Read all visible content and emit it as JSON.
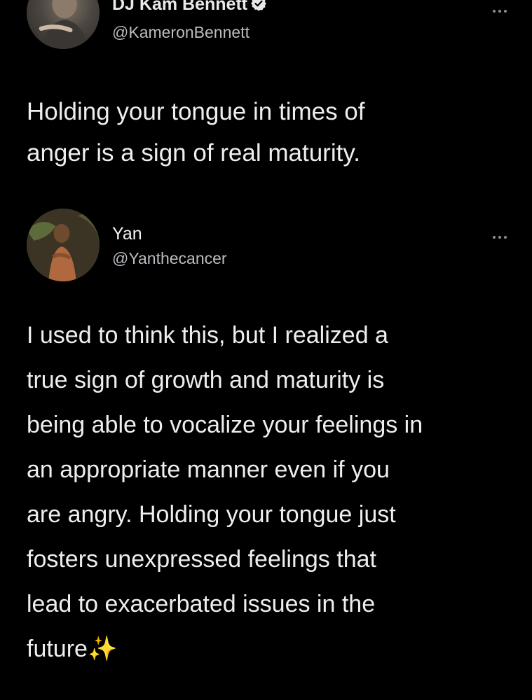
{
  "tweets": [
    {
      "display_name": "DJ Kam Bennett",
      "handle": "@KameronBennett",
      "verified": true,
      "avatar": "profile-photo",
      "more_icon": "more-dots-icon",
      "text": "Holding your tongue in times of\nanger is a sign of real maturity."
    },
    {
      "display_name": "Yan",
      "handle": "@Yanthecancer",
      "verified": false,
      "avatar": "profile-photo",
      "more_icon": "more-dots-icon",
      "text": "I used to think this, but I realized a\ntrue sign of growth and maturity is\nbeing able to vocalize your feelings in\nan appropriate manner even if you\nare angry. Holding your tongue just\nfosters unexpressed feelings that\nlead to exacerbated issues in the\nfuture✨"
    }
  ],
  "colors": {
    "background": "#000000",
    "text": "#e7e9ea",
    "secondary_text": "#b9bcc0",
    "verified_badge": "#e7e9ea"
  }
}
